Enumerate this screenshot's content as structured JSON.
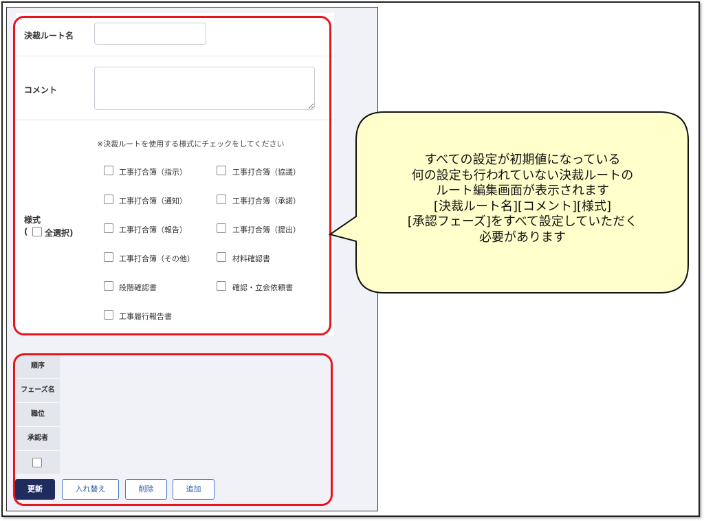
{
  "form": {
    "route_name_label": "決裁ルート名",
    "route_name_value": "",
    "comment_label": "コメント",
    "comment_value": "",
    "forms_label": "様式",
    "forms_select_all_open": "(",
    "forms_select_all_label": "全選択)",
    "forms_note": "※決裁ルートを使用する様式にチェックをしてください",
    "checkbox_items": [
      "工事打合簿（指示）",
      "工事打合簿（協議）",
      "工事打合簿（通知）",
      "工事打合簿（承諾）",
      "工事打合簿（報告）",
      "工事打合簿（提出）",
      "工事打合簿（その他）",
      "材料確認書",
      "段階確認書",
      "確認・立会依頼書",
      "工事履行報告書"
    ]
  },
  "phase": {
    "headers": [
      "順序",
      "フェーズ名",
      "職位",
      "承認者"
    ]
  },
  "buttons": {
    "update": "更新",
    "swap": "入れ替え",
    "delete": "削除",
    "add": "追加"
  },
  "callout": {
    "lines": [
      "すべての設定が初期値になっている",
      "何の設定も行われていない決裁ルートの",
      "ルート編集画面が表示されます",
      "[決裁ルート名][コメント][様式]",
      "[承認フェーズ]をすべて設定していただく",
      "必要があります"
    ]
  },
  "colors": {
    "highlight_border": "#e8141b",
    "callout_fill": "#ffffcc",
    "primary_button": "#1e2d5e",
    "outline_button": "#4a78c8"
  }
}
